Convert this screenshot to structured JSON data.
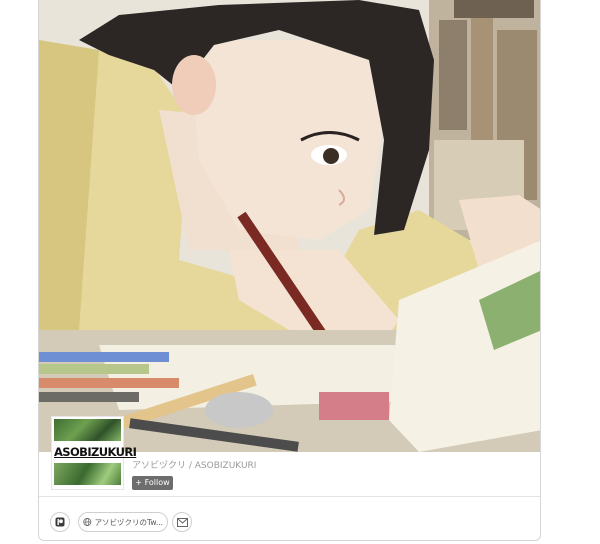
{
  "creator": {
    "avatar_brand": "ASOBIZUKURI",
    "name_line": "アソビヅクリ / ASOBIZUKURI",
    "follow_label": "+ Follow"
  },
  "social": {
    "patreon_icon": "patreon-icon",
    "twitter_label": "アソビヅクリのTw...",
    "globe_icon": "globe-icon",
    "mail_icon": "mail-icon"
  },
  "colors": {
    "follow_bg": "#6d6d6d",
    "card_border": "#d6d6d6",
    "name_text": "#9a9a9a"
  }
}
